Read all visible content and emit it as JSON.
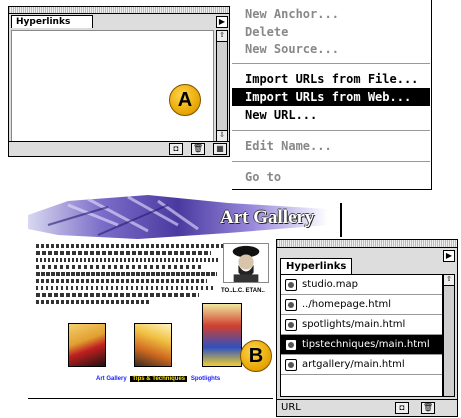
{
  "palette_a": {
    "tab_label": "Hyperlinks"
  },
  "context_menu": {
    "items": [
      {
        "label": "New Anchor...",
        "state": "disabled"
      },
      {
        "label": "Delete",
        "state": "disabled"
      },
      {
        "label": "New Source...",
        "state": "disabled"
      },
      {
        "label": "Import URLs from File...",
        "state": "enabled"
      },
      {
        "label": "Import URLs from Web...",
        "state": "selected"
      },
      {
        "label": "New URL...",
        "state": "enabled"
      },
      {
        "label": "Edit Name...",
        "state": "disabled"
      },
      {
        "label": "Go to",
        "state": "disabled"
      }
    ]
  },
  "callouts": {
    "a": "A",
    "b": "B"
  },
  "web_page": {
    "title": "Art Gallery",
    "caption": "TO..L.C. ETAN..",
    "links": [
      "Art Gallery",
      "Tips & Techniques",
      "Spotlights"
    ]
  },
  "palette_b": {
    "tab_label": "Hyperlinks",
    "items": [
      {
        "label": "studio.map",
        "selected": false
      },
      {
        "label": "../homepage.html",
        "selected": false
      },
      {
        "label": "spotlights/main.html",
        "selected": false
      },
      {
        "label": "tipstechniques/main.html",
        "selected": true
      },
      {
        "label": "artgallery/main.html",
        "selected": false
      }
    ],
    "footer_label": "URL"
  },
  "colors": {
    "selection": "#000000",
    "disabled_text": "#888888",
    "callout": "#f2b500",
    "link_blue": "#1a1aff",
    "link_highlight": "#ffe600"
  }
}
